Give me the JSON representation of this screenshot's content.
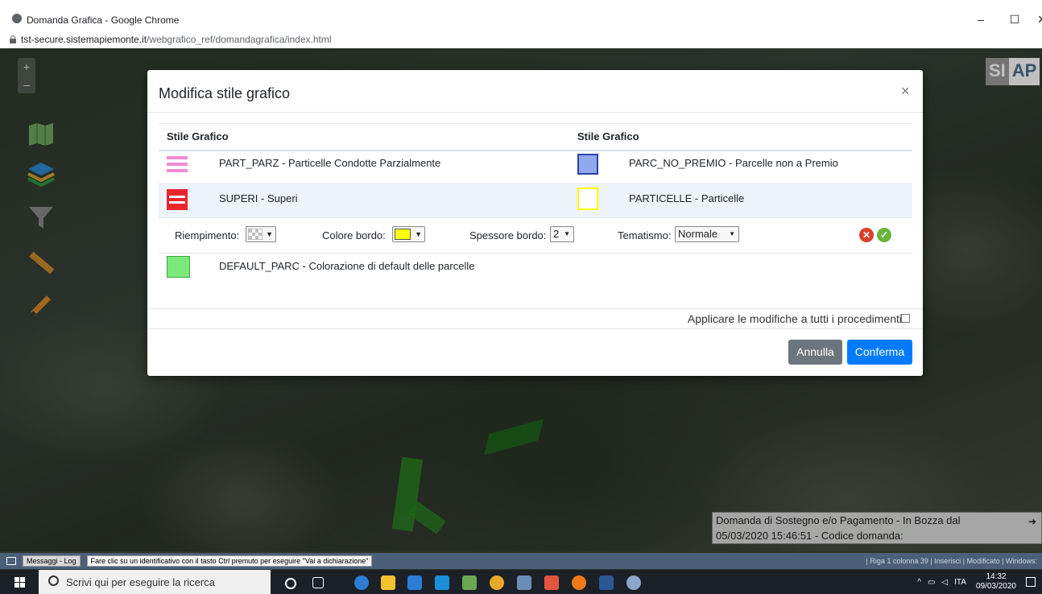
{
  "window": {
    "title": "Domanda Grafica - Google Chrome",
    "minimize": "–",
    "maximize": "☐",
    "close": "✕"
  },
  "address": {
    "host": "tst-secure.sistemapiemonte.it",
    "path": "/webgrafico_ref/domandagrafica/index.html"
  },
  "map": {
    "zoom_in": "+",
    "zoom_out": "–",
    "logo_left": "SI",
    "logo_right": "AP",
    "info_line1": "Domanda di Sostegno e/o Pagamento - In Bozza dal",
    "info_line2": "05/03/2020 15:46:51 - Codice domanda:",
    "info_arrow": "➜"
  },
  "modal": {
    "title": "Modifica stile grafico",
    "close": "×",
    "col1_header": "Stile Grafico",
    "col2_header": "Stile Grafico",
    "rows": [
      {
        "left": {
          "label": "PART_PARZ - Particelle Condotte Parzialmente",
          "color": "#f08cd2"
        },
        "right": {
          "label": "PARC_NO_PREMIO - Parcelle non a Premio",
          "color": "#8fa8f0"
        }
      },
      {
        "left": {
          "label": "SUPERI - Superi",
          "color": "#e8252d"
        },
        "right": {
          "label": "PARTICELLE - Particelle",
          "color": "#ffff00"
        }
      },
      {
        "left": {
          "label": "DEFAULT_PARC - Colorazione di default delle parcelle",
          "color": "#7ce87a"
        }
      }
    ],
    "edit": {
      "fill_label": "Riempimento:",
      "border_color_label": "Colore bordo:",
      "border_color": "#ffff00",
      "thickness_label": "Spessore bordo:",
      "thickness_value": "2",
      "theme_label": "Tematismo:",
      "theme_value": "Normale",
      "cancel_icon": "✕",
      "confirm_icon": "✓"
    },
    "apply_all_label": "Applicare le modifiche a tutti i procedimenti",
    "cancel_button": "Annulla",
    "confirm_button": "Conferma"
  },
  "statusbar": {
    "log_button": "Messaggi - Log",
    "hint": "Fare clic su un identificativo con il tasto Ctrl premuto per eseguire \"Vai a dichiarazione\"",
    "right": "| Riga 1 colonna 39    | Inserisci   | Modificato | Windows:"
  },
  "taskbar": {
    "search_placeholder": "Scrivi qui per eseguire la ricerca",
    "language": "ITA",
    "time": "14:32",
    "date": "09/03/2020"
  }
}
